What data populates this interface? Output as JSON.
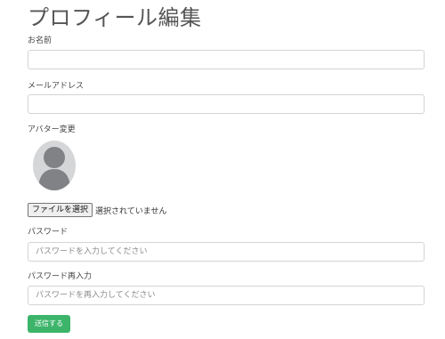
{
  "page": {
    "title": "プロフィール編集"
  },
  "form": {
    "name": {
      "label": "お名前",
      "value": "",
      "placeholder": ""
    },
    "email": {
      "label": "メールアドレス",
      "value": "",
      "placeholder": ""
    },
    "avatar": {
      "label": "アバター変更",
      "icon": "default-user-avatar"
    },
    "file": {
      "button_label": "ファイルを選択",
      "status": "選択されていません"
    },
    "password": {
      "label": "パスワード",
      "placeholder": "パスワードを入力してください"
    },
    "password_confirm": {
      "label": "パスワード再入力",
      "placeholder": "パスワードを再入力してください"
    },
    "submit_label": "送信する"
  },
  "colors": {
    "submit_bg": "#3cb56a",
    "avatar_bg": "#d5d6d8",
    "avatar_figure": "#808285"
  }
}
